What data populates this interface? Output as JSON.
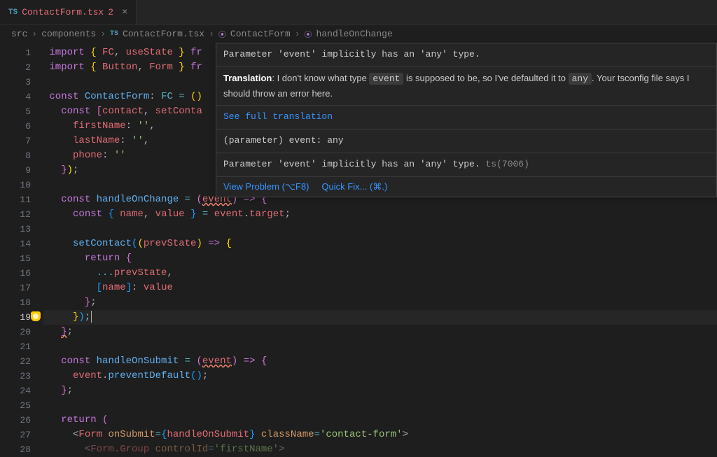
{
  "tab": {
    "icon_label": "TS",
    "filename": "ContactForm.tsx",
    "problem_count": "2"
  },
  "breadcrumb": {
    "parts": [
      "src",
      "components"
    ],
    "file_icon": "TS",
    "file": "ContactForm.tsx",
    "symbols": [
      "ContactForm",
      "handleOnChange"
    ]
  },
  "lines": {
    "1": "import { FC, useState } fr",
    "2": "import { Button, Form } fr",
    "3": "",
    "4": "const ContactForm: FC = ()",
    "5": "  const [contact, setConta",
    "6": "    firstName: '',",
    "7": "    lastName: '',",
    "8": "    phone: ''",
    "9": "  });",
    "10": "",
    "11": "  const handleOnChange = (event) => {",
    "12": "    const { name, value } = event.target;",
    "13": "",
    "14": "    setContact((prevState) => {",
    "15": "      return {",
    "16": "        ...prevState,",
    "17": "        [name]: value",
    "18": "      };",
    "19": "    });",
    "20": "  };",
    "21": "",
    "22": "  const handleOnSubmit = (event) => {",
    "23": "    event.preventDefault();",
    "24": "  };",
    "25": "",
    "26": "  return (",
    "27": "    <Form onSubmit={handleOnSubmit} className='contact-form'>",
    "28": "      <Form.Group controlId='firstName'>"
  },
  "active_line": "19",
  "hover": {
    "msg1": "Parameter 'event' implicitly has an 'any' type.",
    "translation_label": "Translation",
    "translation_pre": ": I don't know what type ",
    "event_code": "event",
    "translation_mid": " is supposed to be, so I've defaulted it to ",
    "any_code": "any",
    "translation_post": ". Your tsconfig file says I should throw an error here.",
    "see_full": "See full translation",
    "signature": "(parameter) event: any",
    "msg2": "Parameter 'event' implicitly has an 'any' type.",
    "code": "ts(7006)",
    "view_problem": "View Problem",
    "view_problem_shortcut": "(⌥F8)",
    "quick_fix": "Quick Fix...",
    "quick_fix_shortcut": "(⌘.)"
  }
}
